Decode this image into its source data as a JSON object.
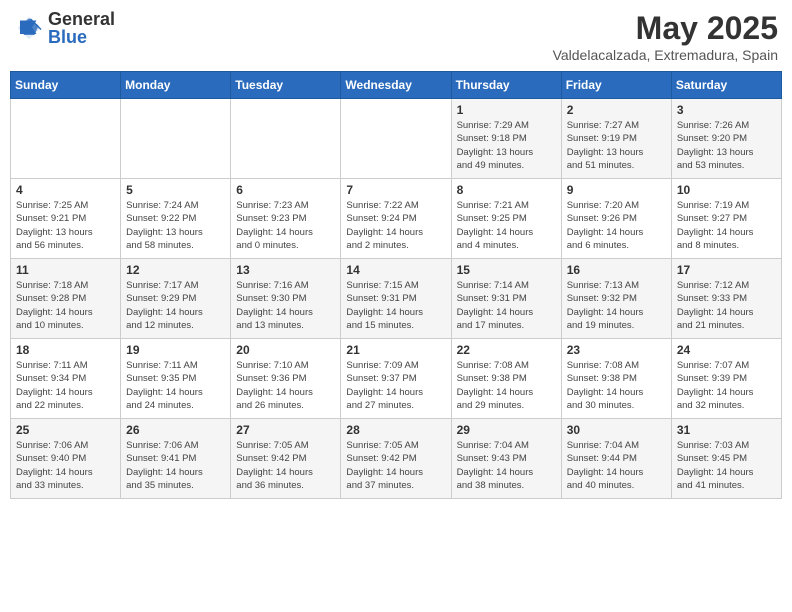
{
  "header": {
    "logo_general": "General",
    "logo_blue": "Blue",
    "title": "May 2025",
    "location": "Valdelacalzada, Extremadura, Spain"
  },
  "days_of_week": [
    "Sunday",
    "Monday",
    "Tuesday",
    "Wednesday",
    "Thursday",
    "Friday",
    "Saturday"
  ],
  "weeks": [
    [
      {
        "day": "",
        "info": ""
      },
      {
        "day": "",
        "info": ""
      },
      {
        "day": "",
        "info": ""
      },
      {
        "day": "",
        "info": ""
      },
      {
        "day": "1",
        "info": "Sunrise: 7:29 AM\nSunset: 9:18 PM\nDaylight: 13 hours\nand 49 minutes."
      },
      {
        "day": "2",
        "info": "Sunrise: 7:27 AM\nSunset: 9:19 PM\nDaylight: 13 hours\nand 51 minutes."
      },
      {
        "day": "3",
        "info": "Sunrise: 7:26 AM\nSunset: 9:20 PM\nDaylight: 13 hours\nand 53 minutes."
      }
    ],
    [
      {
        "day": "4",
        "info": "Sunrise: 7:25 AM\nSunset: 9:21 PM\nDaylight: 13 hours\nand 56 minutes."
      },
      {
        "day": "5",
        "info": "Sunrise: 7:24 AM\nSunset: 9:22 PM\nDaylight: 13 hours\nand 58 minutes."
      },
      {
        "day": "6",
        "info": "Sunrise: 7:23 AM\nSunset: 9:23 PM\nDaylight: 14 hours\nand 0 minutes."
      },
      {
        "day": "7",
        "info": "Sunrise: 7:22 AM\nSunset: 9:24 PM\nDaylight: 14 hours\nand 2 minutes."
      },
      {
        "day": "8",
        "info": "Sunrise: 7:21 AM\nSunset: 9:25 PM\nDaylight: 14 hours\nand 4 minutes."
      },
      {
        "day": "9",
        "info": "Sunrise: 7:20 AM\nSunset: 9:26 PM\nDaylight: 14 hours\nand 6 minutes."
      },
      {
        "day": "10",
        "info": "Sunrise: 7:19 AM\nSunset: 9:27 PM\nDaylight: 14 hours\nand 8 minutes."
      }
    ],
    [
      {
        "day": "11",
        "info": "Sunrise: 7:18 AM\nSunset: 9:28 PM\nDaylight: 14 hours\nand 10 minutes."
      },
      {
        "day": "12",
        "info": "Sunrise: 7:17 AM\nSunset: 9:29 PM\nDaylight: 14 hours\nand 12 minutes."
      },
      {
        "day": "13",
        "info": "Sunrise: 7:16 AM\nSunset: 9:30 PM\nDaylight: 14 hours\nand 13 minutes."
      },
      {
        "day": "14",
        "info": "Sunrise: 7:15 AM\nSunset: 9:31 PM\nDaylight: 14 hours\nand 15 minutes."
      },
      {
        "day": "15",
        "info": "Sunrise: 7:14 AM\nSunset: 9:31 PM\nDaylight: 14 hours\nand 17 minutes."
      },
      {
        "day": "16",
        "info": "Sunrise: 7:13 AM\nSunset: 9:32 PM\nDaylight: 14 hours\nand 19 minutes."
      },
      {
        "day": "17",
        "info": "Sunrise: 7:12 AM\nSunset: 9:33 PM\nDaylight: 14 hours\nand 21 minutes."
      }
    ],
    [
      {
        "day": "18",
        "info": "Sunrise: 7:11 AM\nSunset: 9:34 PM\nDaylight: 14 hours\nand 22 minutes."
      },
      {
        "day": "19",
        "info": "Sunrise: 7:11 AM\nSunset: 9:35 PM\nDaylight: 14 hours\nand 24 minutes."
      },
      {
        "day": "20",
        "info": "Sunrise: 7:10 AM\nSunset: 9:36 PM\nDaylight: 14 hours\nand 26 minutes."
      },
      {
        "day": "21",
        "info": "Sunrise: 7:09 AM\nSunset: 9:37 PM\nDaylight: 14 hours\nand 27 minutes."
      },
      {
        "day": "22",
        "info": "Sunrise: 7:08 AM\nSunset: 9:38 PM\nDaylight: 14 hours\nand 29 minutes."
      },
      {
        "day": "23",
        "info": "Sunrise: 7:08 AM\nSunset: 9:38 PM\nDaylight: 14 hours\nand 30 minutes."
      },
      {
        "day": "24",
        "info": "Sunrise: 7:07 AM\nSunset: 9:39 PM\nDaylight: 14 hours\nand 32 minutes."
      }
    ],
    [
      {
        "day": "25",
        "info": "Sunrise: 7:06 AM\nSunset: 9:40 PM\nDaylight: 14 hours\nand 33 minutes."
      },
      {
        "day": "26",
        "info": "Sunrise: 7:06 AM\nSunset: 9:41 PM\nDaylight: 14 hours\nand 35 minutes."
      },
      {
        "day": "27",
        "info": "Sunrise: 7:05 AM\nSunset: 9:42 PM\nDaylight: 14 hours\nand 36 minutes."
      },
      {
        "day": "28",
        "info": "Sunrise: 7:05 AM\nSunset: 9:42 PM\nDaylight: 14 hours\nand 37 minutes."
      },
      {
        "day": "29",
        "info": "Sunrise: 7:04 AM\nSunset: 9:43 PM\nDaylight: 14 hours\nand 38 minutes."
      },
      {
        "day": "30",
        "info": "Sunrise: 7:04 AM\nSunset: 9:44 PM\nDaylight: 14 hours\nand 40 minutes."
      },
      {
        "day": "31",
        "info": "Sunrise: 7:03 AM\nSunset: 9:45 PM\nDaylight: 14 hours\nand 41 minutes."
      }
    ]
  ]
}
